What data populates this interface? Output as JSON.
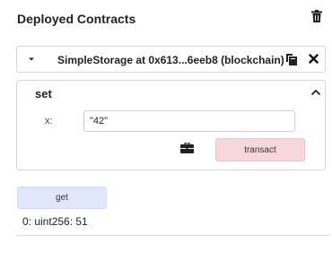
{
  "panel": {
    "title": "Deployed Contracts"
  },
  "instance": {
    "name": "SimpleStorage at 0x613...6eeb8 (blockchain)"
  },
  "set_function": {
    "name": "set",
    "param_label": "x:",
    "param_value": "\"42\"",
    "transact_label": "transact"
  },
  "get_function": {
    "label": "get",
    "result": "0: uint256: 51"
  },
  "icons": {
    "trash": "trash-icon",
    "caret": "caret-down-icon",
    "copy": "copy-icon",
    "close": "close-icon",
    "collapse": "chevron-up-icon",
    "briefcase": "briefcase-icon"
  },
  "colors": {
    "transact_bg": "#f8d7da",
    "get_bg": "#e0e6fb"
  }
}
